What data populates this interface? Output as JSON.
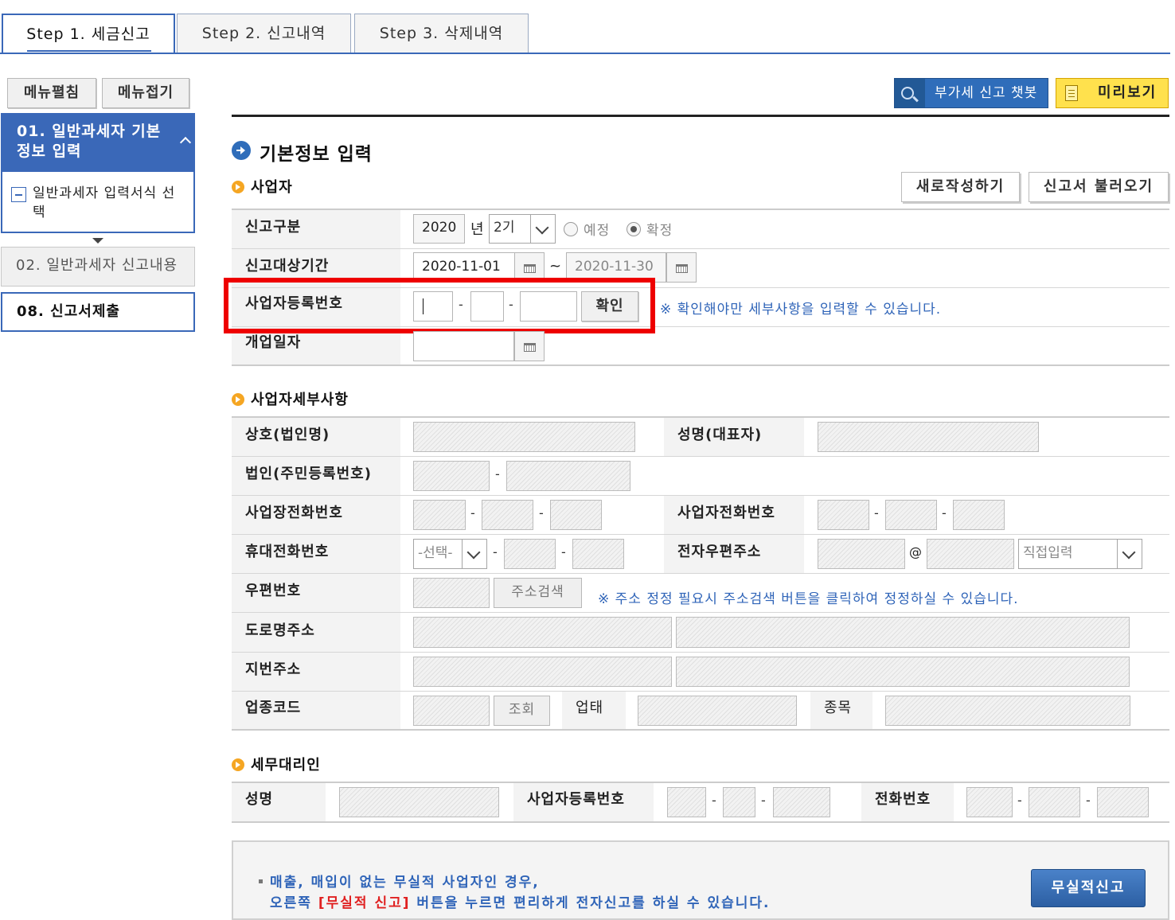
{
  "tabs": [
    "Step  1. 세금신고",
    "Step  2. 신고내역",
    "Step  3. 삭제내역"
  ],
  "sidebar": {
    "expand_label": "메뉴펼침",
    "collapse_label": "메뉴접기",
    "step1_title": "01. 일반과세자 기본정보 입력",
    "step1_sub": "일반과세자 입력서식 선택",
    "step2_title": "02. 일반과세자 신고내용",
    "step3_title": "08. 신고서제출"
  },
  "toolbar": {
    "chatbot_label": "부가세 신고 챗봇",
    "preview_label": "미리보기"
  },
  "main": {
    "title": "기본정보 입력",
    "business": {
      "title": "사업자",
      "new_button": "새로작성하기",
      "load_button": "신고서 불러오기",
      "report_type_label": "신고구분",
      "year": "2020",
      "year_unit": "년",
      "period": "2기",
      "radio_expected": "예정",
      "radio_confirmed": "확정",
      "period_label": "신고대상기간",
      "date_from": "2020-11-01",
      "date_sep": "~",
      "date_to": "2020-11-30",
      "brn_label": "사업자등록번호",
      "confirm_button": "확인",
      "brn_note": "※ 확인해야만 세부사항을 입력할 수 있습니다.",
      "open_date_label": "개업일자"
    },
    "details": {
      "title": "사업자세부사항",
      "company_label": "상호(법인명)",
      "rep_label": "성명(대표자)",
      "corp_id_label": "법인(주민등록번호)",
      "biz_phone_label": "사업장전화번호",
      "owner_phone_label": "사업자전화번호",
      "mobile_label": "휴대전화번호",
      "mobile_select": "-선택-",
      "email_label": "전자우편주소",
      "email_at": "@",
      "email_domain_select": "직접입력",
      "zip_label": "우편번호",
      "address_search_button": "주소검색",
      "address_note": "※ 주소 정정 필요시 주소검색 버튼을 클릭하여 정정하실 수 있습니다.",
      "road_address_label": "도로명주소",
      "lot_address_label": "지번주소",
      "industry_code_label": "업종코드",
      "lookup_button": "조회",
      "business_type_label": "업태",
      "business_item_label": "종목"
    },
    "agent": {
      "title": "세무대리인",
      "name_label": "성명",
      "brn_label": "사업자등록번호",
      "phone_label": "전화번호"
    },
    "notice": {
      "line1": "매출, 매입이 없는 무실적 사업자인 경우,",
      "line2_pre": "오른쪽 ",
      "line2_highlight": "[무실적 신고]",
      "line2_post": " 버튼을 누르면 편리하게 전자신고를 하실 수 있습니다.",
      "button": "무실적신고"
    }
  },
  "colors": {
    "accent_blue": "#3a68b8",
    "highlight_red": "#ee0000",
    "preview_yellow": "#ffe14d"
  }
}
